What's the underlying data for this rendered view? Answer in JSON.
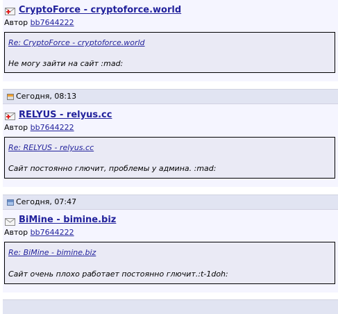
{
  "posts": [
    {
      "date": "",
      "title": "CryptoForce - cryptoforce.world",
      "author_prefix": "Автор",
      "author": "bb7644222",
      "quote_link": "Re: CryptoForce - cryptoforce.world",
      "quote_text": "Не могу зайти на сайт :mad:",
      "icon": "mail-delete-icon"
    },
    {
      "date": "Сегодня, 08:13",
      "title": "RELYUS - relyus.cc",
      "author_prefix": "Автор",
      "author": "bb7644222",
      "quote_link": "Re: RELYUS - relyus.cc",
      "quote_text": "Сайт постоянно глючит, проблемы у админа. :mad:",
      "icon": "mail-delete-icon",
      "date_icon": "old-post-icon"
    },
    {
      "date": "Сегодня, 07:47",
      "title": "BiMine - bimine.biz",
      "author_prefix": "Автор",
      "author": "bb7644222",
      "quote_link": "Re: BiMine - bimine.biz",
      "quote_text": "Сайт очень плохо работает постоянно глючит.:t-1doh:",
      "icon": "mail-icon",
      "date_icon": "new-post-icon"
    }
  ]
}
